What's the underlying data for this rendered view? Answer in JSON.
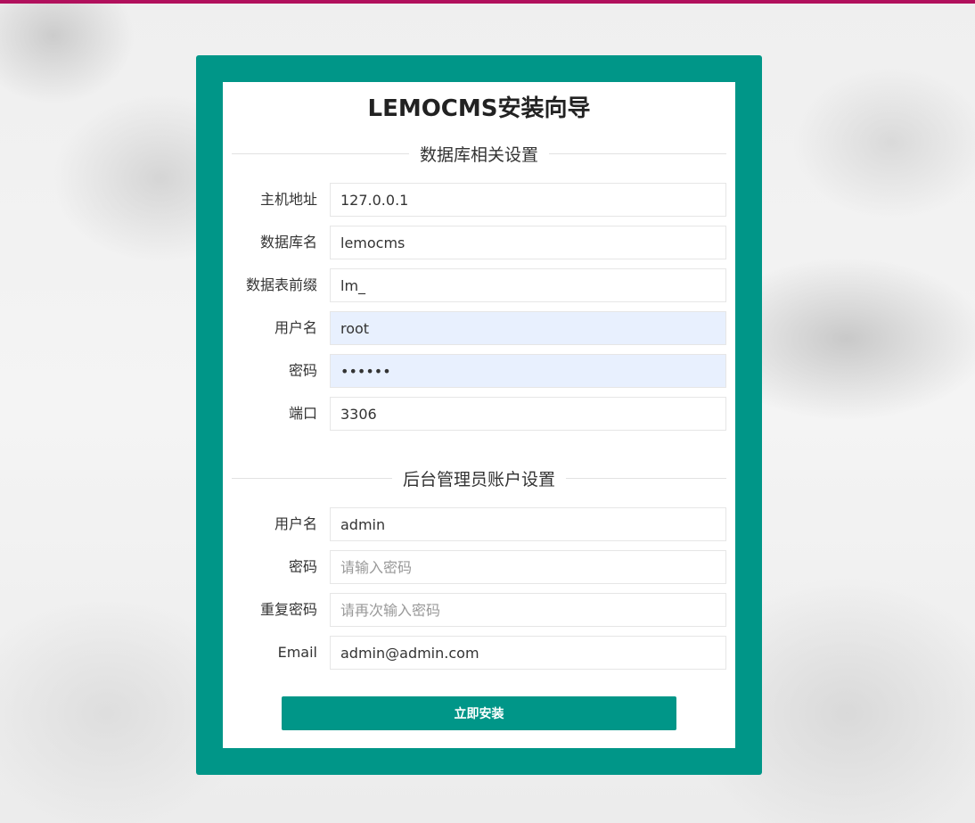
{
  "page": {
    "title": "LEMOCMS安装向导",
    "accent_color": "#009688",
    "top_bar_color": "#b1105c"
  },
  "db_section": {
    "heading": "数据库相关设置",
    "fields": [
      {
        "label": "主机地址",
        "value": "127.0.0.1",
        "placeholder": "",
        "type": "text"
      },
      {
        "label": "数据库名",
        "value": "lemocms",
        "placeholder": "",
        "type": "text"
      },
      {
        "label": "数据表前缀",
        "value": "lm_",
        "placeholder": "",
        "type": "text"
      },
      {
        "label": "用户名",
        "value": "root",
        "placeholder": "",
        "type": "text"
      },
      {
        "label": "密码",
        "value": "••••••",
        "placeholder": "",
        "type": "password"
      },
      {
        "label": "端口",
        "value": "3306",
        "placeholder": "",
        "type": "text"
      }
    ]
  },
  "admin_section": {
    "heading": "后台管理员账户设置",
    "fields": [
      {
        "label": "用户名",
        "value": "admin",
        "placeholder": "",
        "type": "text"
      },
      {
        "label": "密码",
        "value": "",
        "placeholder": "请输入密码",
        "type": "password"
      },
      {
        "label": "重复密码",
        "value": "",
        "placeholder": "请再次输入密码",
        "type": "password"
      },
      {
        "label": "Email",
        "value": "admin@admin.com",
        "placeholder": "",
        "type": "text"
      }
    ]
  },
  "install_button": {
    "label": "立即安装"
  }
}
